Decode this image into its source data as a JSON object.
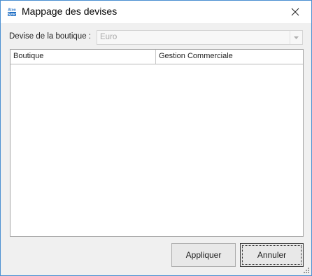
{
  "window": {
    "title": "Mappage des devises",
    "app_icon": "atoo-sync-icon",
    "app_icon_text_top": "Atoo",
    "app_icon_text_bottom": "Sync",
    "close_icon": "close-icon"
  },
  "form": {
    "currency_label": "Devise de la boutique :",
    "currency_value": "Euro",
    "dropdown_icon": "chevron-down-icon"
  },
  "grid": {
    "columns": [
      "Boutique",
      "Gestion Commerciale"
    ],
    "rows": []
  },
  "buttons": {
    "apply_label": "Appliquer",
    "cancel_label": "Annuler"
  },
  "colors": {
    "window_border": "#4a8fd1",
    "background": "#f0f0f0",
    "icon_blue": "#1f6fc5"
  }
}
